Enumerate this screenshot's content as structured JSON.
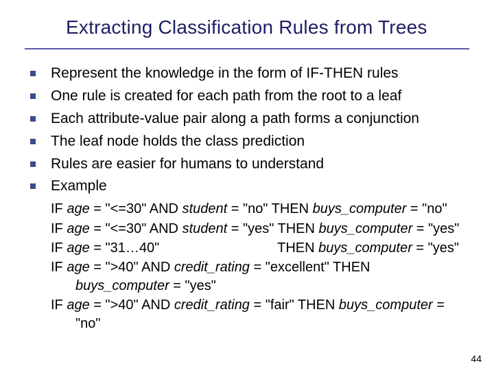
{
  "title": "Extracting Classification Rules from Trees",
  "bullets": [
    "Represent the knowledge in the form of IF-THEN rules",
    "One rule is created for each path from the root to a leaf",
    "Each attribute-value pair along a path forms a conjunction",
    "The leaf node holds the class prediction",
    "Rules are easier for humans to understand",
    "Example"
  ],
  "ex": {
    "r1": {
      "if": "IF ",
      "age": "age",
      "eq1": " = \"<=30\" AND ",
      "student": "student",
      "eq2": " = \"no\"   THEN ",
      "buys": "buys_computer",
      "res": " = \"no\""
    },
    "r2": {
      "if": "IF ",
      "age": "age",
      "eq1": " = \"<=30\" AND ",
      "student": "student",
      "eq2": " = \"yes\"  THEN ",
      "buys": "buys_computer",
      "res": " = \"yes\""
    },
    "r3": {
      "if": "IF ",
      "age": "age",
      "eq1": " = \"31…40\"",
      "sp": "                               THEN ",
      "buys": "buys_computer",
      "res": " = \"yes\""
    },
    "r4a": {
      "if": "IF ",
      "age": "age",
      "eq1": " = \">40\"   AND ",
      "cr": "credit_rating",
      "eq2": " = \"excellent\"   THEN"
    },
    "r4b": {
      "buys": "buys_computer",
      "res": " = \"yes\""
    },
    "r5a": {
      "if": "IF ",
      "age": "age",
      "eq1": " = \">40\" AND ",
      "cr": "credit_rating",
      "eq2": " = \"fair\"  THEN ",
      "buys": "buys_computer",
      "res": " ="
    },
    "r5b": {
      "val": "\"no\""
    }
  },
  "page": "44"
}
